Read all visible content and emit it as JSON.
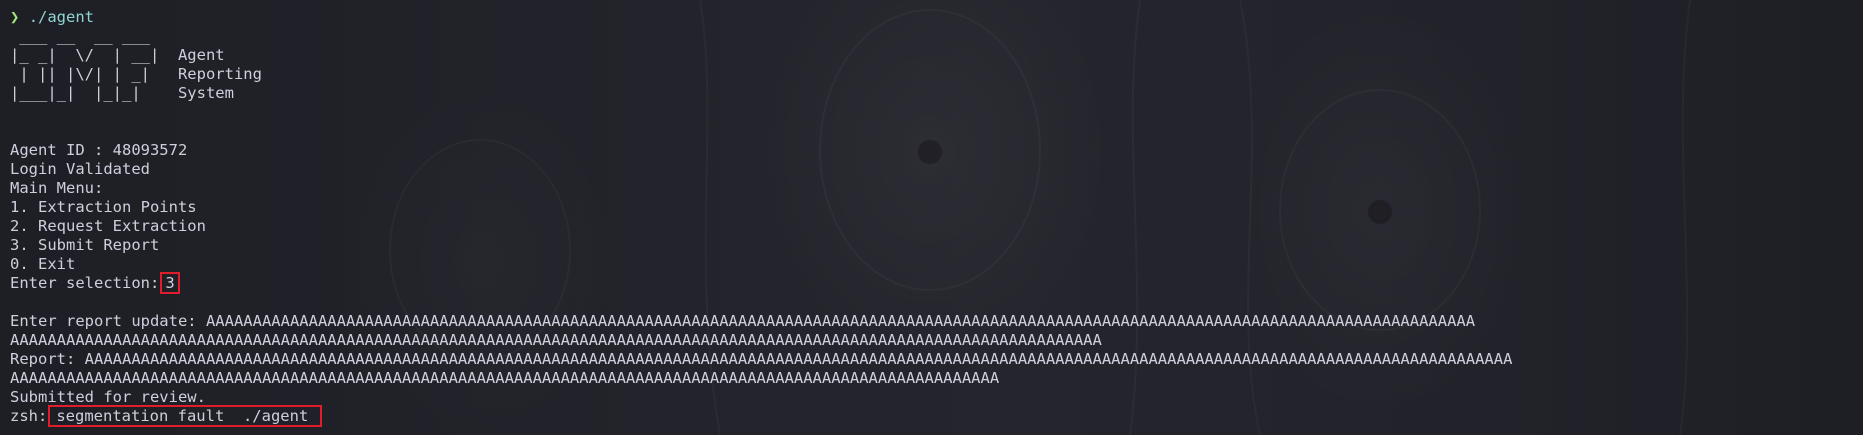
{
  "prompt": {
    "arrow": "❯",
    "command": "./agent"
  },
  "banner": {
    "row1": " ___ __  __ ___",
    "row2": "|_ _|  \\/  | __|  Agent",
    "row3": " | || |\\/| | _|   Reporting",
    "row4": "|___|_|  |_|_|    System"
  },
  "session": {
    "agent_id_line": "Agent ID : 48093572",
    "login_status": "Login Validated",
    "menu_title": "Main Menu:",
    "menu_items": [
      "1. Extraction Points",
      "2. Request Extraction",
      "3. Submit Report",
      "0. Exit"
    ],
    "selection_label": "Enter selection:",
    "selection_value": "3",
    "report_prompt": "Enter report update: AAAAAAAAAAAAAAAAAAAAAAAAAAAAAAAAAAAAAAAAAAAAAAAAAAAAAAAAAAAAAAAAAAAAAAAAAAAAAAAAAAAAAAAAAAAAAAAAAAAAAAAAAAAAAAAAAAAAAAAAAAAAAAAAAAAAAAAA",
    "report_prompt_wrap": "AAAAAAAAAAAAAAAAAAAAAAAAAAAAAAAAAAAAAAAAAAAAAAAAAAAAAAAAAAAAAAAAAAAAAAAAAAAAAAAAAAAAAAAAAAAAAAAAAAAAAAAAAAAAAAAAAAAAA",
    "report_echo": "Report: AAAAAAAAAAAAAAAAAAAAAAAAAAAAAAAAAAAAAAAAAAAAAAAAAAAAAAAAAAAAAAAAAAAAAAAAAAAAAAAAAAAAAAAAAAAAAAAAAAAAAAAAAAAAAAAAAAAAAAAAAAAAAAAAAAAAAAAAAAAAAAAAAAAAAAAAA",
    "report_echo_wrap": "AAAAAAAAAAAAAAAAAAAAAAAAAAAAAAAAAAAAAAAAAAAAAAAAAAAAAAAAAAAAAAAAAAAAAAAAAAAAAAAAAAAAAAAAAAAAAAAAAAAAAAAAAA",
    "submitted": "Submitted for review.",
    "shell_label": "zsh:",
    "error": "segmentation fault  ./agent"
  },
  "colors": {
    "highlight_box": "#e21d2b",
    "prompt_arrow": "#a6e37a",
    "command": "#8fd4cf",
    "text": "#cdd0dc"
  }
}
